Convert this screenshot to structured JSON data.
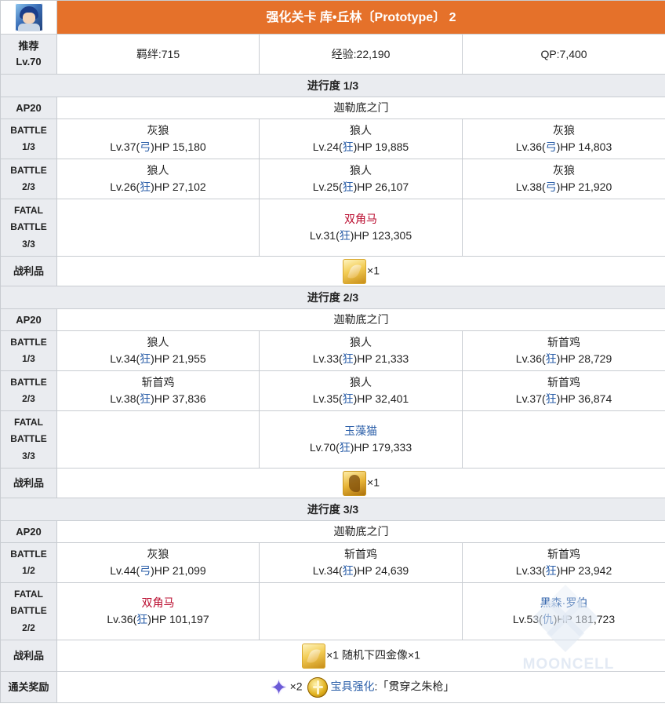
{
  "title": "强化关卡 库•丘林〔Prototype〕 2",
  "recommend_label": "推荐\nLv.70",
  "recommend": {
    "bond": "羁绊:715",
    "exp": "经验:22,190",
    "qp": "QP:7,400"
  },
  "labels": {
    "ap": "AP20",
    "drops": "战利品",
    "clear_reward": "通关奖励"
  },
  "stages": [
    {
      "progress": "进行度 1/3",
      "location": "迦勒底之门",
      "battles": [
        {
          "label": "BATTLE\n1/3",
          "enemies": [
            {
              "name": "灰狼",
              "pre": "Lv.37(",
              "cls": "弓",
              "post": ")HP 15,180"
            },
            {
              "name": "狼人",
              "pre": "Lv.24(",
              "cls": "狂",
              "post": ")HP 19,885"
            },
            {
              "name": "灰狼",
              "pre": "Lv.36(",
              "cls": "弓",
              "post": ")HP 14,803"
            }
          ]
        },
        {
          "label": "BATTLE\n2/3",
          "enemies": [
            {
              "name": "狼人",
              "pre": "Lv.26(",
              "cls": "狂",
              "post": ")HP 27,102"
            },
            {
              "name": "狼人",
              "pre": "Lv.25(",
              "cls": "狂",
              "post": ")HP 26,107"
            },
            {
              "name": "灰狼",
              "pre": "Lv.38(",
              "cls": "弓",
              "post": ")HP 21,920"
            }
          ]
        }
      ],
      "fatal": {
        "label": "FATAL\nBATTLE\n3/3",
        "name": "双角马",
        "pre": "Lv.31(",
        "cls": "狂",
        "post": ")HP 123,305"
      },
      "drop_text": "×1",
      "drop_icon": "golden-feather-icon"
    },
    {
      "progress": "进行度 2/3",
      "location": "迦勒底之门",
      "battles": [
        {
          "label": "BATTLE\n1/3",
          "enemies": [
            {
              "name": "狼人",
              "pre": "Lv.34(",
              "cls": "狂",
              "post": ")HP 21,955"
            },
            {
              "name": "狼人",
              "pre": "Lv.33(",
              "cls": "狂",
              "post": ")HP 21,333"
            },
            {
              "name": "斩首鸡",
              "pre": "Lv.36(",
              "cls": "狂",
              "post": ")HP 28,729"
            }
          ]
        },
        {
          "label": "BATTLE\n2/3",
          "enemies": [
            {
              "name": "斩首鸡",
              "pre": "Lv.38(",
              "cls": "狂",
              "post": ")HP 37,836"
            },
            {
              "name": "狼人",
              "pre": "Lv.35(",
              "cls": "狂",
              "post": ")HP 32,401"
            },
            {
              "name": "斩首鸡",
              "pre": "Lv.37(",
              "cls": "狂",
              "post": ")HP 36,874"
            }
          ]
        }
      ],
      "fatal": {
        "label": "FATAL\nBATTLE\n3/3",
        "name": "玉藻猫",
        "pre": "Lv.70(",
        "cls": "狂",
        "post": ")HP 179,333"
      },
      "drop_text": "×1",
      "drop_icon": "dragon-claw-icon"
    }
  ],
  "stage3": {
    "progress": "进行度 3/3",
    "location": "迦勒底之门",
    "battle1": {
      "label": "BATTLE\n1/2",
      "enemies": [
        {
          "name": "灰狼",
          "pre": "Lv.44(",
          "cls": "弓",
          "post": ")HP 21,099"
        },
        {
          "name": "斩首鸡",
          "pre": "Lv.34(",
          "cls": "狂",
          "post": ")HP 24,639"
        },
        {
          "name": "斩首鸡",
          "pre": "Lv.33(",
          "cls": "狂",
          "post": ")HP 23,942"
        }
      ]
    },
    "fatal": {
      "label": "FATAL\nBATTLE\n2/2",
      "left": {
        "name": "双角马",
        "pre": "Lv.36(",
        "cls": "狂",
        "post": ")HP 101,197"
      },
      "right": {
        "name": "黑森·罗伯",
        "pre": "Lv.53(",
        "cls": "仇",
        "post": ")HP 181,723"
      }
    },
    "drop_text": "×1 随机下四金像×1",
    "drop_icon": "golden-feather-icon"
  },
  "reward": {
    "star_text": "×2",
    "np_link": "宝具强化",
    "np_text": ":「贯穿之朱枪」",
    "star_icon": "saint-quartz-icon",
    "np_icon": "np-upgrade-icon"
  },
  "watermark": "MOONCELL"
}
